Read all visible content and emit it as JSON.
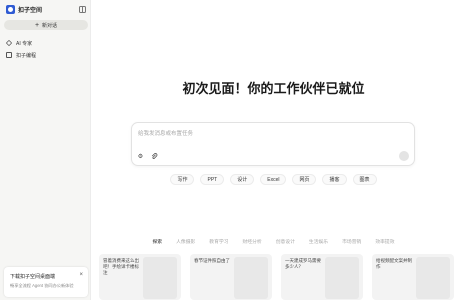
{
  "sidebar": {
    "brand_name": "扣子空间",
    "new_chat_label": "新对话",
    "items": [
      {
        "label": "AI 专家",
        "icon": "layers-icon"
      },
      {
        "label": "扣子编程",
        "icon": "document-icon"
      }
    ],
    "download_card": {
      "title": "下载扣子空间桌面端",
      "description": "畅享全流程 Agent 协同办公新体验"
    }
  },
  "main": {
    "hero_title": "初次见面！你的工作伙伴已就位",
    "composer": {
      "placeholder": "给我发消息或布置任务"
    },
    "chips": [
      "写作",
      "PPT",
      "设计",
      "Excel",
      "网页",
      "播客",
      "图表"
    ],
    "tabs": [
      "探索",
      "人像摄影",
      "教育学习",
      "财经分析",
      "创意设计",
      "生活娱乐",
      "市场营销",
      "效率提效"
    ],
    "active_tab_index": 0,
    "cards": [
      {
        "text": "冒着消费来这么出吧！手绘详卡楼标注"
      },
      {
        "text": "春节证件照自由了"
      },
      {
        "text": "一天建成罗马需要多少人？"
      },
      {
        "text": "给视频配文案并制作"
      }
    ]
  }
}
